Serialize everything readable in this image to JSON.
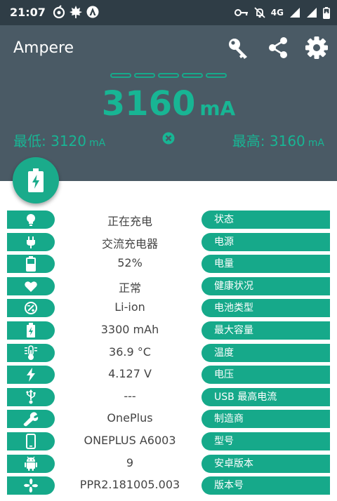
{
  "status_bar": {
    "time": "21:07",
    "network": "4G"
  },
  "app": {
    "title": "Ampere"
  },
  "header_icons": [
    "key-icon",
    "share-icon",
    "settings-icon"
  ],
  "meter": {
    "current_value": "3160",
    "current_unit": "mA",
    "min_label": "最低: 3120",
    "min_unit": "mA",
    "max_label": "最高: 3160",
    "max_unit": "mA"
  },
  "colors": {
    "accent": "#16a98a",
    "header_bg": "#4a5a65",
    "status_bg": "#2f3d46"
  },
  "rows": [
    {
      "icon": "bulb-icon",
      "value": "正在充电",
      "label": "状态"
    },
    {
      "icon": "plug-icon",
      "value": "交流充电器",
      "label": "电源"
    },
    {
      "icon": "battery-icon",
      "value": "52%",
      "label": "电量"
    },
    {
      "icon": "heart-icon",
      "value": "正常",
      "label": "健康状况"
    },
    {
      "icon": "battery-type-icon",
      "value": "Li-ion",
      "label": "电池类型"
    },
    {
      "icon": "battery-capacity-icon",
      "value": "3300 mAh",
      "label": "最大容量"
    },
    {
      "icon": "thermometer-icon",
      "value": "36.9 °C",
      "label": "温度"
    },
    {
      "icon": "bolt-icon",
      "value": "4.127 V",
      "label": "电压"
    },
    {
      "icon": "usb-icon",
      "value": "---",
      "label": "USB 最高电流"
    },
    {
      "icon": "wrench-icon",
      "value": "OnePlus",
      "label": "制造商"
    },
    {
      "icon": "phone-icon",
      "value": "ONEPLUS A6003",
      "label": "型号"
    },
    {
      "icon": "android-icon",
      "value": "9",
      "label": "安卓版本"
    },
    {
      "icon": "fan-icon",
      "value": "PPR2.181005.003",
      "label": "版本号"
    }
  ]
}
